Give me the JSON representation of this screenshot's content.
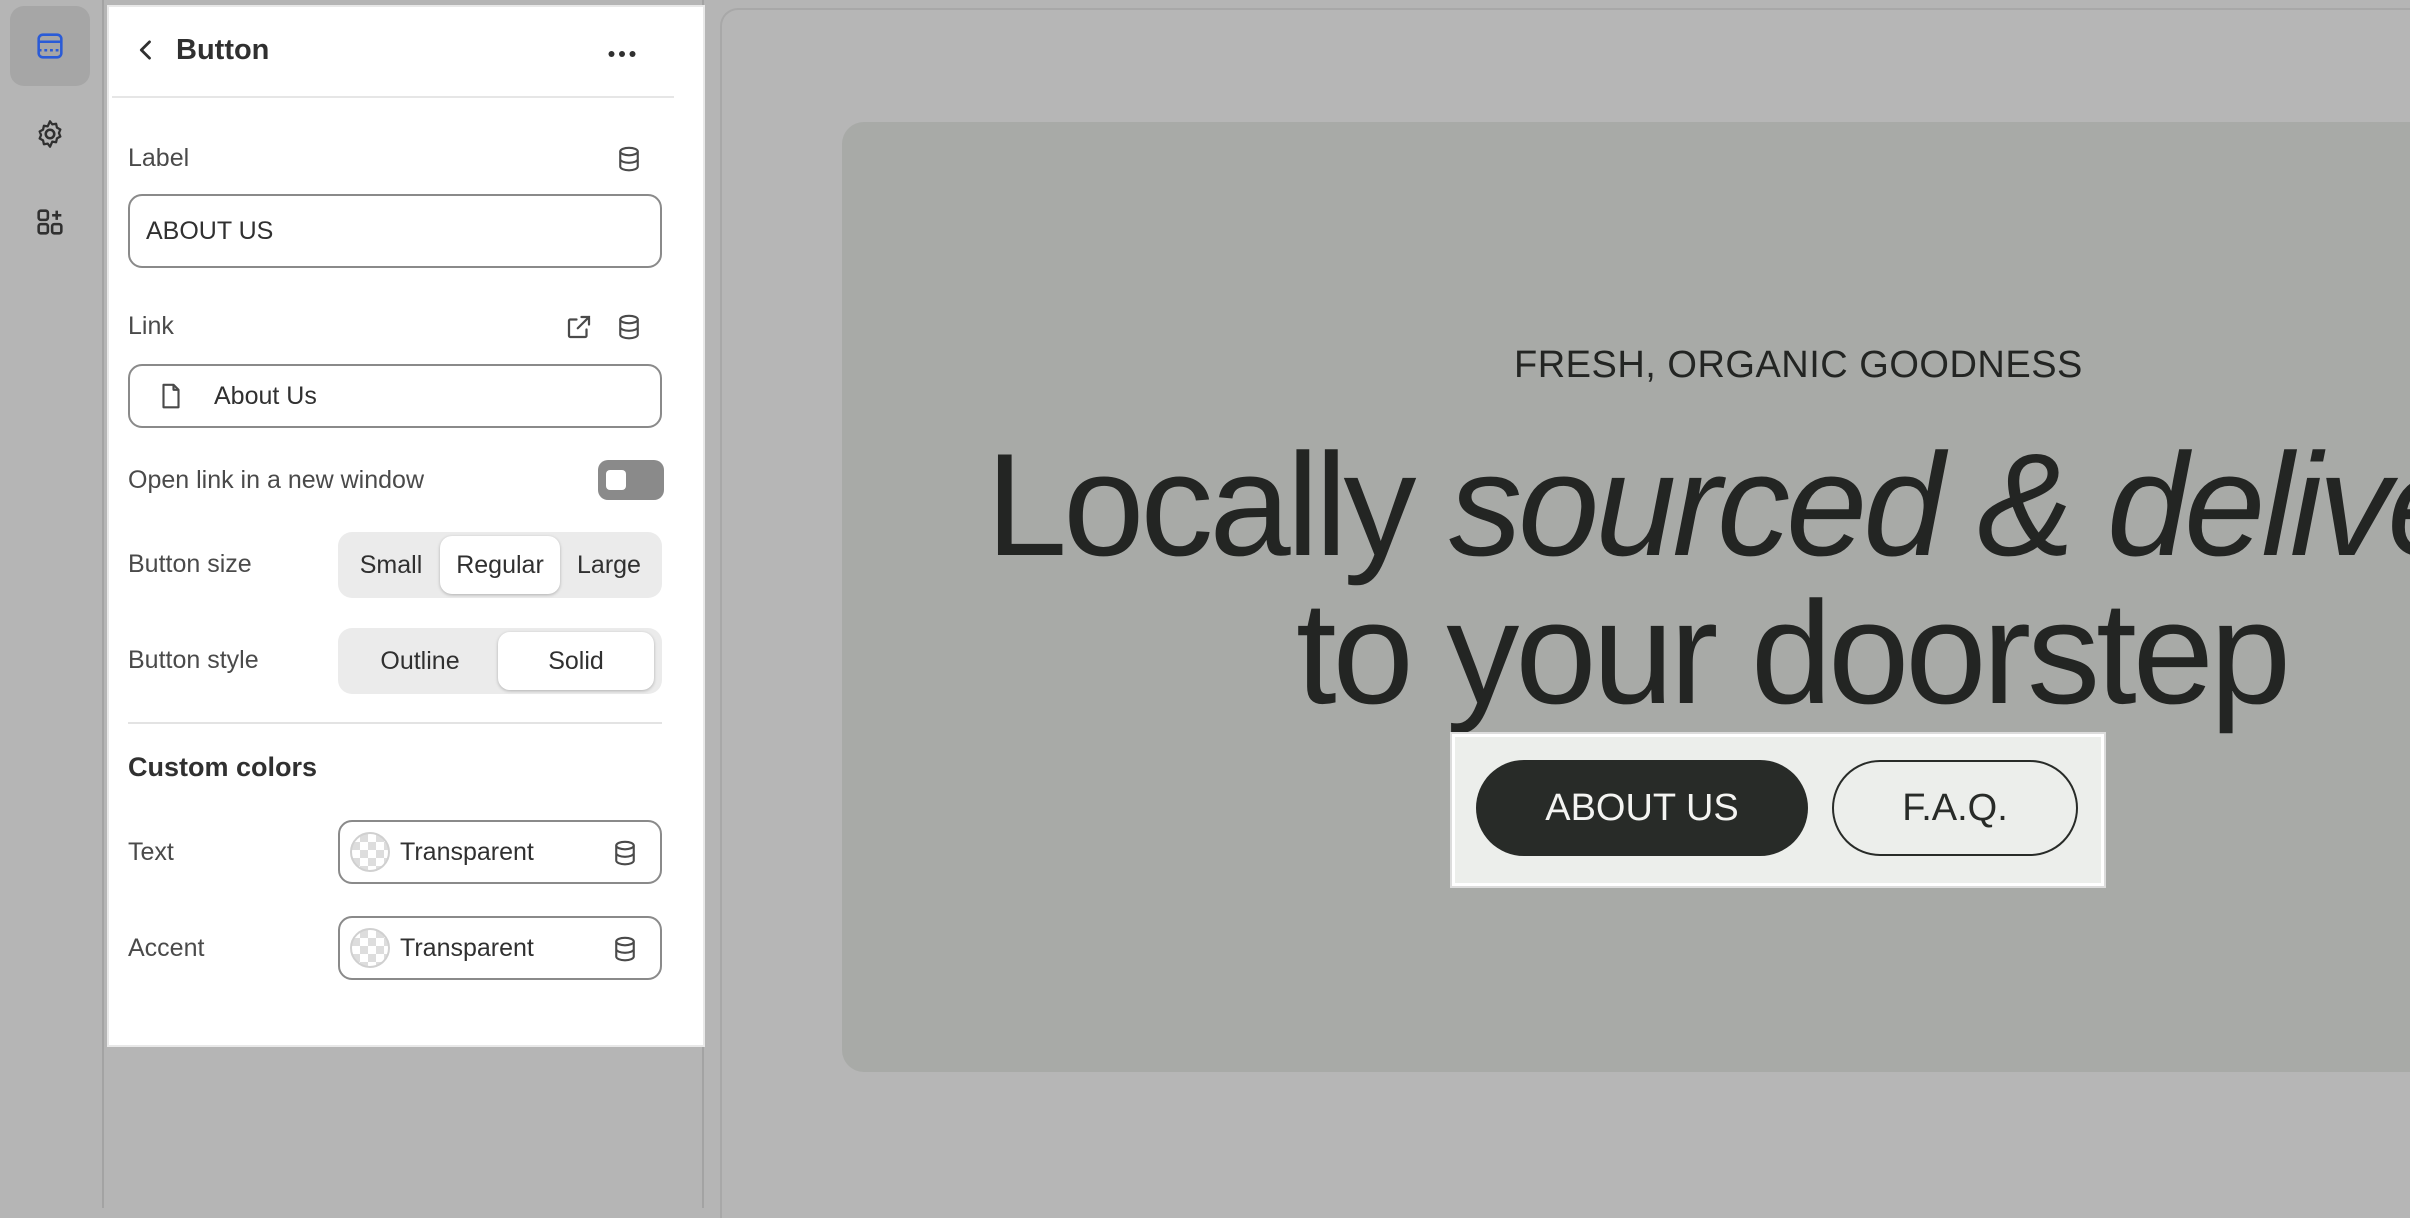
{
  "rail": {
    "items": [
      {
        "icon": "sections-icon",
        "active": true
      },
      {
        "icon": "gear-icon",
        "active": false
      },
      {
        "icon": "apps-icon",
        "active": false
      }
    ]
  },
  "panel": {
    "title": "Button",
    "label_field": {
      "label": "Label",
      "value": "ABOUT US"
    },
    "link_field": {
      "label": "Link",
      "value": "About Us"
    },
    "open_new_window": {
      "label": "Open link in a new window",
      "checked": false
    },
    "button_size": {
      "label": "Button size",
      "options": [
        "Small",
        "Regular",
        "Large"
      ],
      "selected": "Regular"
    },
    "button_style": {
      "label": "Button style",
      "options": [
        "Outline",
        "Solid"
      ],
      "selected": "Solid"
    },
    "custom_colors": {
      "title": "Custom colors",
      "text": {
        "label": "Text",
        "value": "Transparent"
      },
      "accent": {
        "label": "Accent",
        "value": "Transparent"
      }
    }
  },
  "preview": {
    "eyebrow": "FRESH, ORGANIC GOODNESS",
    "headline_line1_regular": "Locally ",
    "headline_line1_italic": "sourced & deliver",
    "headline_line2": "to your doorstep",
    "primary_button": "ABOUT US",
    "secondary_button": "F.A.Q."
  },
  "colors": {
    "accent_dark": "#282b28",
    "hero_bg": "#a8aaa7",
    "canvas_bg": "#b5b5b5"
  }
}
